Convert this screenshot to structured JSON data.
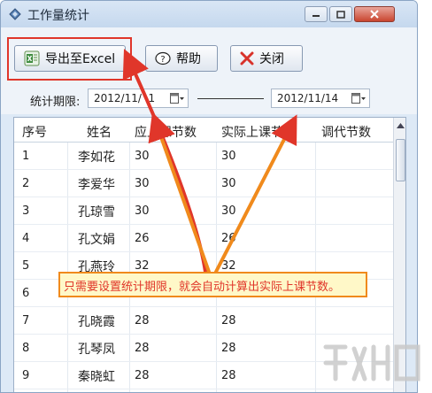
{
  "window": {
    "title": "工作量统计"
  },
  "toolbar": {
    "export_label": "导出至Excel",
    "help_label": "帮助",
    "close_label": "关闭"
  },
  "filter": {
    "label": "统计期限:",
    "start_date": "2012/11/  1",
    "end_date": "2012/11/14"
  },
  "grid": {
    "columns": [
      "序号",
      "姓名",
      "应上课节数",
      "实际上课节数",
      "调代节数"
    ],
    "rows": [
      {
        "num": "1",
        "name": "李如花",
        "scheduled": "30",
        "actual": "30"
      },
      {
        "num": "2",
        "name": "李爱华",
        "scheduled": "30",
        "actual": "30"
      },
      {
        "num": "3",
        "name": "孔琼雪",
        "scheduled": "30",
        "actual": "30"
      },
      {
        "num": "4",
        "name": "孔文娟",
        "scheduled": "26",
        "actual": "26"
      },
      {
        "num": "5",
        "name": "孔燕玲",
        "scheduled": "32",
        "actual": "32"
      },
      {
        "num": "6",
        "name": "",
        "scheduled": "",
        "actual": ""
      },
      {
        "num": "7",
        "name": "孔晓霞",
        "scheduled": "28",
        "actual": "28"
      },
      {
        "num": "8",
        "name": "孔琴凤",
        "scheduled": "28",
        "actual": "28"
      },
      {
        "num": "9",
        "name": "秦晓虹",
        "scheduled": "28",
        "actual": "28"
      }
    ]
  },
  "callout": {
    "text": "只需要设置统计期限，就会自动计算出实际上课节数。"
  },
  "colors": {
    "accent_red": "#e0362a",
    "callout_border": "#f08a1c",
    "callout_bg": "#fff8c8"
  },
  "icons": [
    "app-icon",
    "minimize-icon",
    "maximize-icon",
    "close-icon",
    "excel-icon",
    "help-icon",
    "close-x-icon",
    "calendar-icon",
    "scroll-up-icon"
  ]
}
